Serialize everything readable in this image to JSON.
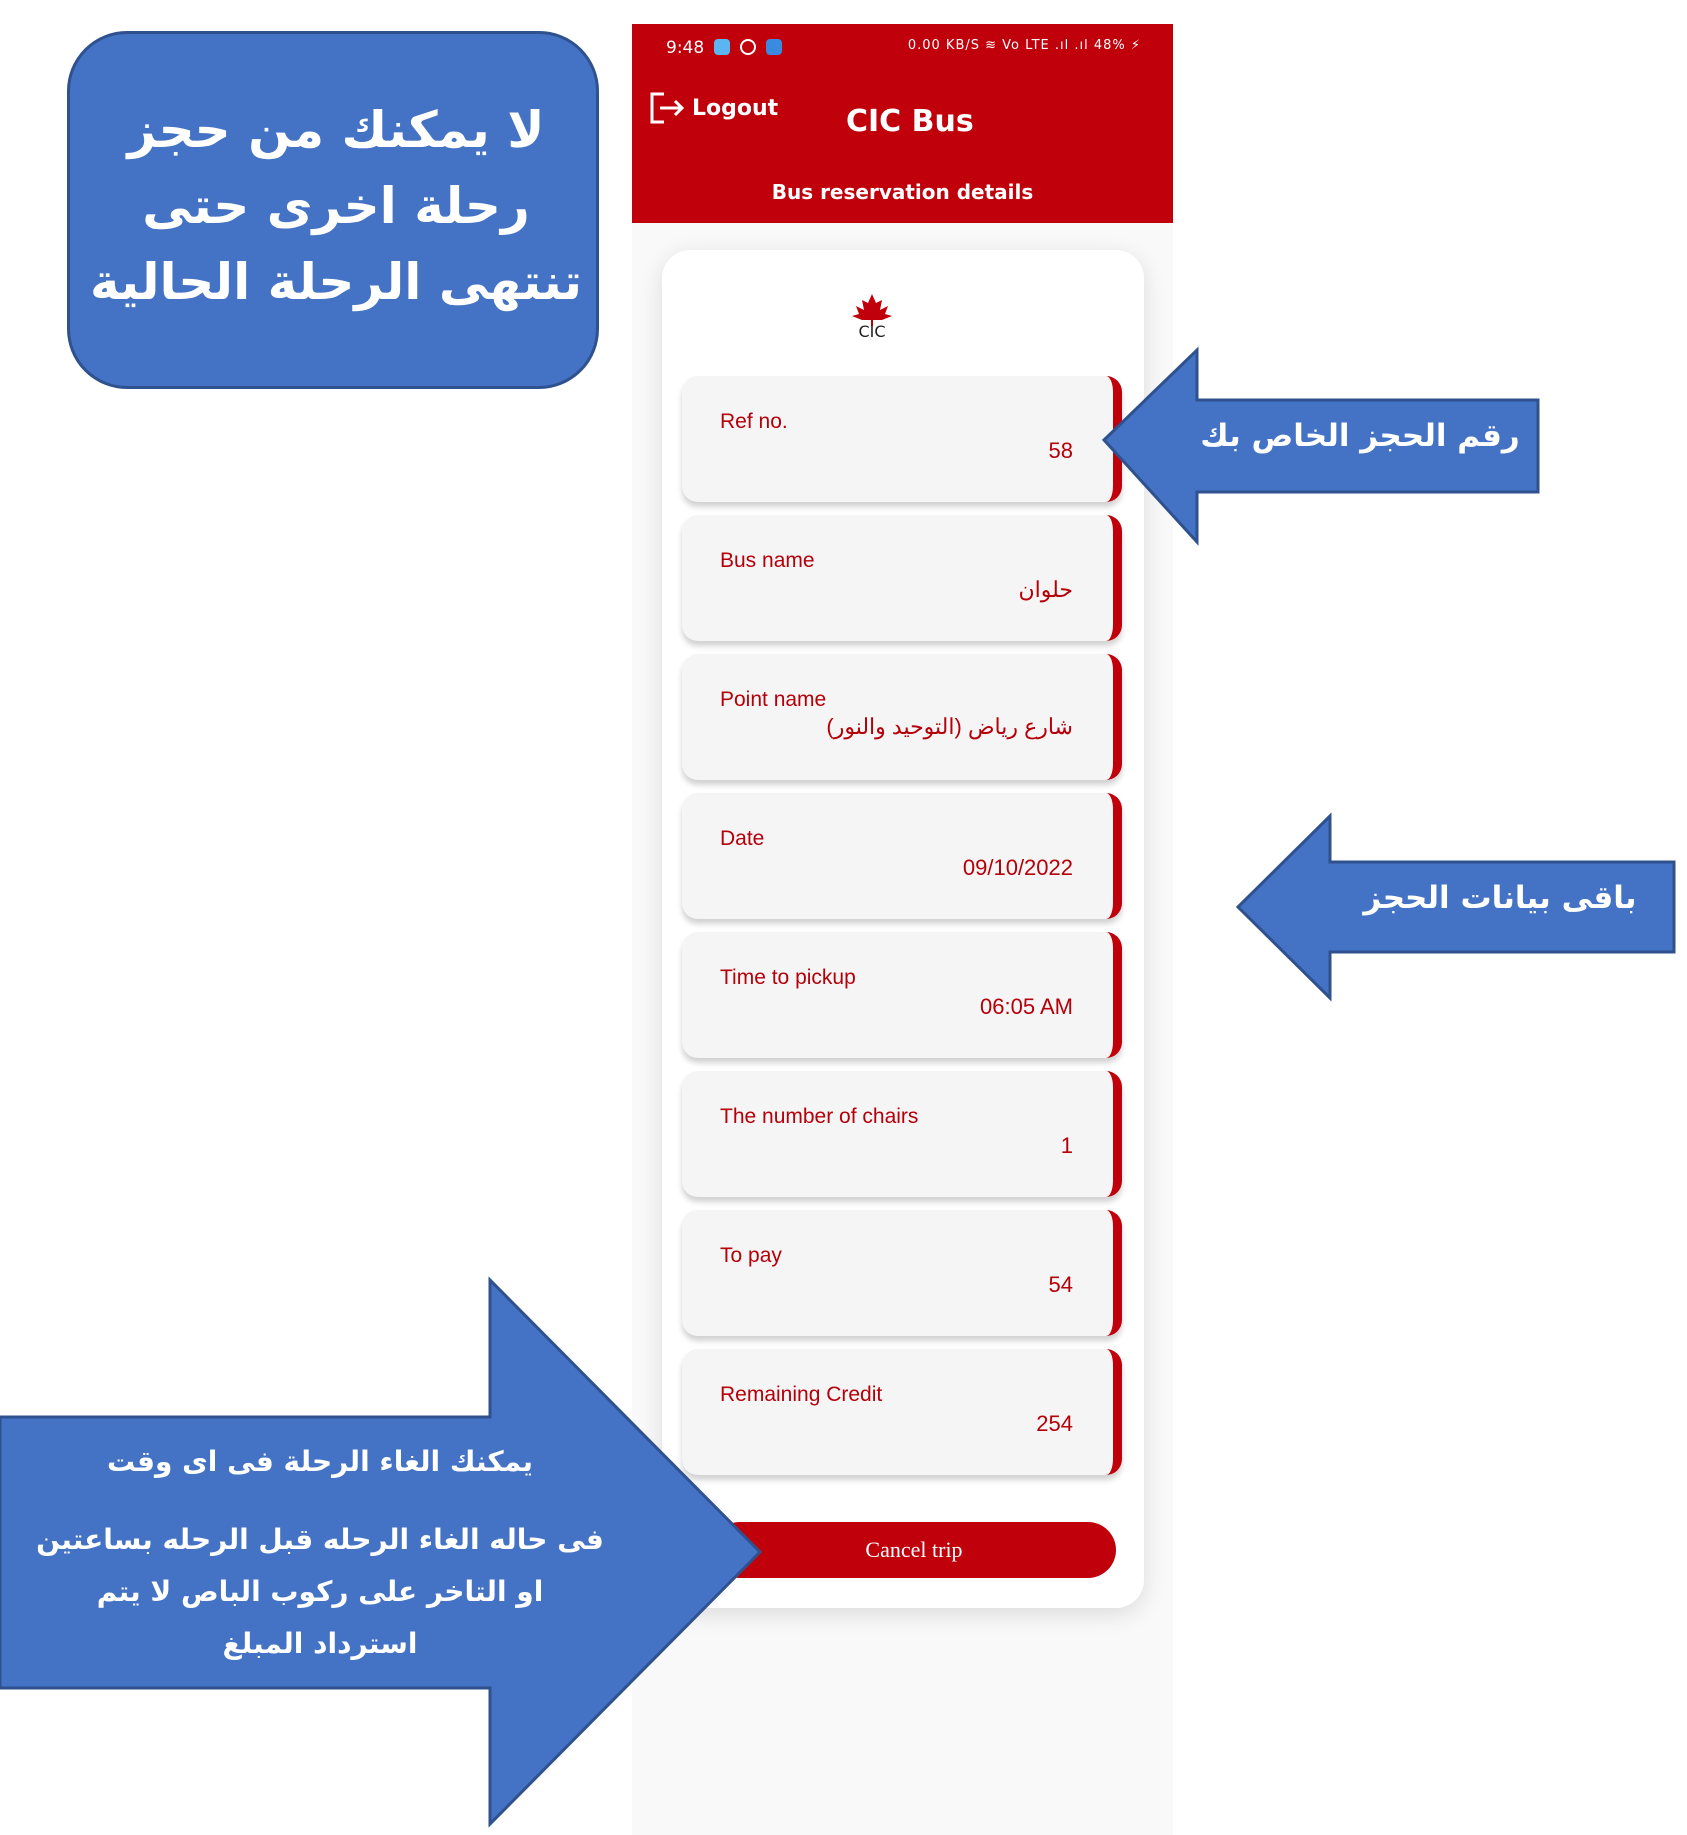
{
  "status_bar": {
    "time": "9:48",
    "right": "0.00 KB/S  ≋  Vo LTE .ıl .ıl 48% ⚡"
  },
  "app": {
    "logout_label": "Logout",
    "title": "CIC Bus",
    "subtitle": "Bus reservation details",
    "logo_text": "CIC"
  },
  "details": [
    {
      "label": "Ref no.",
      "value": "58"
    },
    {
      "label": "Bus name",
      "value": "حلوان"
    },
    {
      "label": "Point name",
      "value": "شارع رياض (التوحيد والنور)"
    },
    {
      "label": "Date",
      "value": "09/10/2022"
    },
    {
      "label": "Time to pickup",
      "value": "06:05 AM"
    },
    {
      "label": "The number of chairs",
      "value": "1"
    },
    {
      "label": "To pay",
      "value": "54"
    },
    {
      "label": "Remaining Credit",
      "value": "254"
    }
  ],
  "cancel_label": "Cancel trip",
  "annotations": {
    "top_callout": [
      "لا يمكنك من حجز",
      "رحلة اخرى حتى",
      "تنتهى الرحلة الحالية"
    ],
    "ref_arrow": "رقم الحجز الخاص بك",
    "details_arrow": "باقى بيانات الحجز",
    "cancel_arrow_line1": "يمكنك الغاء الرحلة فى اى وقت",
    "cancel_arrow_line2": "فى حاله الغاء الرحله قبل الرحله بساعتين",
    "cancel_arrow_line3": "او التاخر على ركوب الباص لا يتم",
    "cancel_arrow_line4": "استرداد المبلغ"
  },
  "colors": {
    "brand_red": "#c0000b",
    "annotation_blue": "#4472c4",
    "annotation_border": "#2f528f"
  }
}
